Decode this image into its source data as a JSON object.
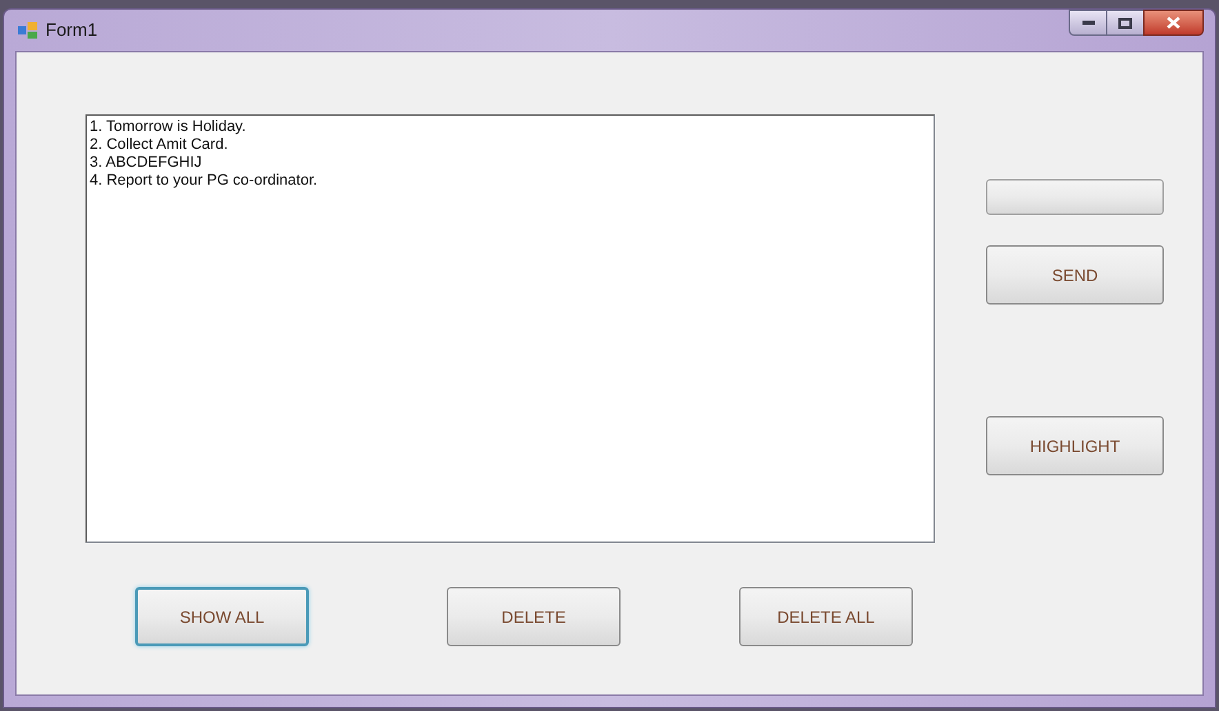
{
  "window": {
    "title": "Form1"
  },
  "listbox": {
    "items": [
      "1. Tomorrow is Holiday.",
      "2. Collect Amit Card.",
      "3. ABCDEFGHIJ",
      "4. Report to your PG co-ordinator."
    ]
  },
  "side_buttons": [
    {
      "kind": "blank"
    },
    {
      "kind": "text",
      "label": "SEND"
    },
    {
      "kind": "text",
      "label": "HIGHLIGHT"
    }
  ],
  "bottom_buttons": [
    {
      "label": "SHOW ALL",
      "focused": true
    },
    {
      "label": "DELETE",
      "focused": false
    },
    {
      "label": "DELETE ALL",
      "focused": false
    }
  ]
}
